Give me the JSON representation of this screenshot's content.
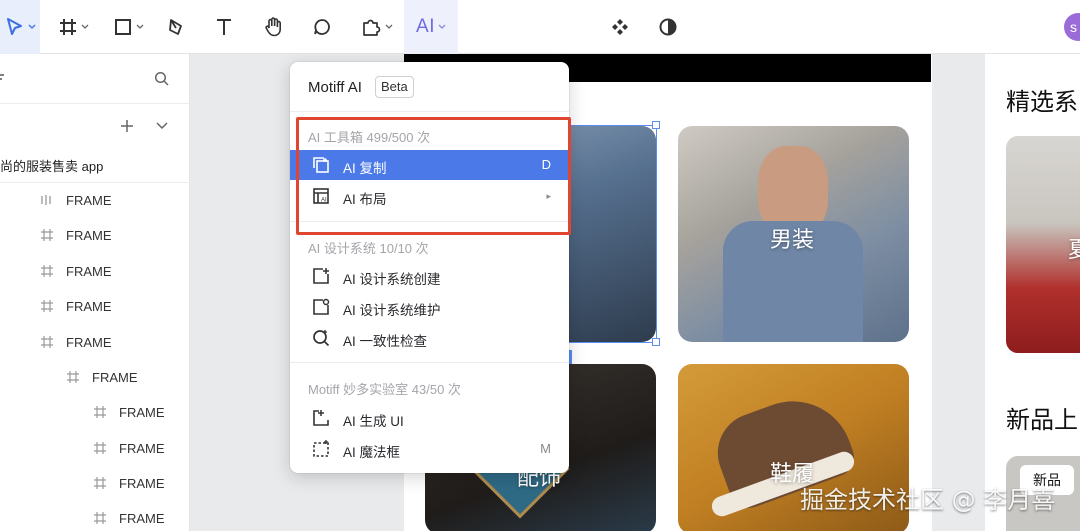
{
  "toolbar": {
    "ai_label": "AI",
    "avatar_letter": "s",
    "tools": [
      "move-tool",
      "frame-tool",
      "rectangle-tool",
      "pen-tool",
      "text-tool",
      "hand-tool",
      "comment-tool",
      "plugin-tool"
    ]
  },
  "left_panel": {
    "project_name": "尚的服装售卖 app",
    "layers": [
      {
        "label": "FRAME",
        "icon": "column-frame-icon"
      },
      {
        "label": "FRAME",
        "icon": "hash-icon"
      },
      {
        "label": "FRAME",
        "icon": "hash-icon"
      },
      {
        "label": "FRAME",
        "icon": "hash-icon"
      },
      {
        "label": "FRAME",
        "icon": "hash-icon"
      },
      {
        "label": "FRAME",
        "icon": "hash-icon"
      },
      {
        "label": "FRAME",
        "icon": "hash-icon"
      },
      {
        "label": "FRAME",
        "icon": "hash-icon"
      },
      {
        "label": "FRAME",
        "icon": "hash-icon"
      },
      {
        "label": "FRAME",
        "icon": "hash-icon"
      }
    ]
  },
  "menu": {
    "title": "Motiff AI",
    "badge": "Beta",
    "sections": [
      {
        "header": "AI 工具箱  499/500 次",
        "items": [
          {
            "label": "AI 复制",
            "shortcut": "D",
            "icon": "ai-copy-icon",
            "selected": true
          },
          {
            "label": "AI 布局",
            "shortcut": "▸",
            "icon": "ai-layout-icon",
            "selected": false
          }
        ]
      },
      {
        "header": "AI 设计系统  10/10 次",
        "items": [
          {
            "label": "AI 设计系统创建",
            "shortcut": "",
            "icon": "ds-create-icon"
          },
          {
            "label": "AI 设计系统维护",
            "shortcut": "",
            "icon": "ds-maintain-icon"
          },
          {
            "label": "AI 一致性检查",
            "shortcut": "",
            "icon": "consistency-check-icon"
          }
        ]
      },
      {
        "header": "Motiff 妙多实验室  43/50 次",
        "items": [
          {
            "label": "AI 生成 UI",
            "shortcut": "",
            "icon": "generate-ui-icon"
          },
          {
            "label": "AI 魔法框",
            "shortcut": "M",
            "icon": "magic-box-icon"
          }
        ]
      }
    ]
  },
  "canvas": {
    "cards": [
      {
        "label": "男装"
      },
      {
        "label": "配饰"
      },
      {
        "label": "鞋履"
      }
    ],
    "right_headings": [
      "精选系",
      "新品上"
    ],
    "right_card_label": "夏",
    "new_badge": "新品",
    "watermark": "掘金技术社区 @ 李月喜"
  },
  "colors": {
    "accent": "#4b7ae8",
    "ai_purple": "#6f6ae6",
    "highlight_red": "#e0452f"
  }
}
